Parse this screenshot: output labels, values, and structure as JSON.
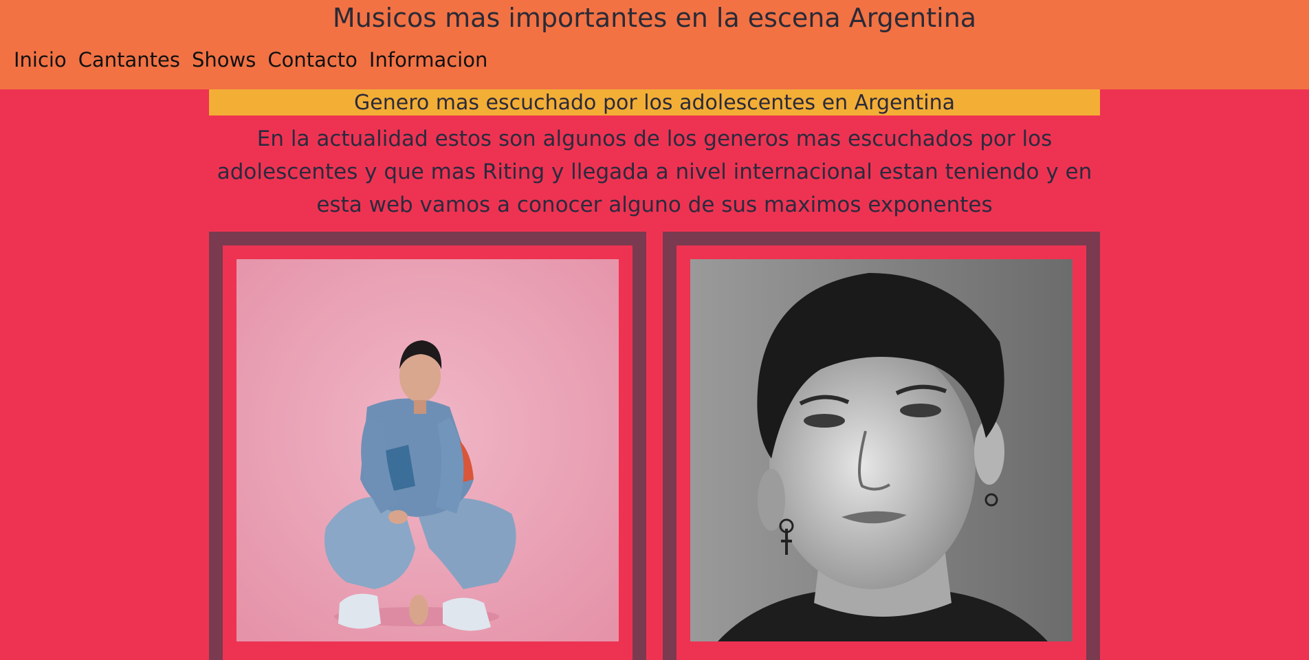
{
  "header": {
    "title": "Musicos mas importantes en la escena Argentina",
    "nav": [
      "Inicio",
      "Cantantes",
      "Shows",
      "Contacto",
      "Informacion"
    ]
  },
  "main": {
    "section_title": "Genero mas escuchado por los adolescentes en Argentina",
    "intro": "En la actualidad estos son algunos de los generos mas escuchados por los adolescentes y que mas Riting y llegada a nivel internacional estan teniendo y en esta web vamos a conocer alguno de sus maximos exponentes"
  },
  "colors": {
    "page_bg": "#ee3352",
    "header_bg": "#f27244",
    "banner_bg": "#f3ae36",
    "card_frame": "#7a3a50"
  }
}
